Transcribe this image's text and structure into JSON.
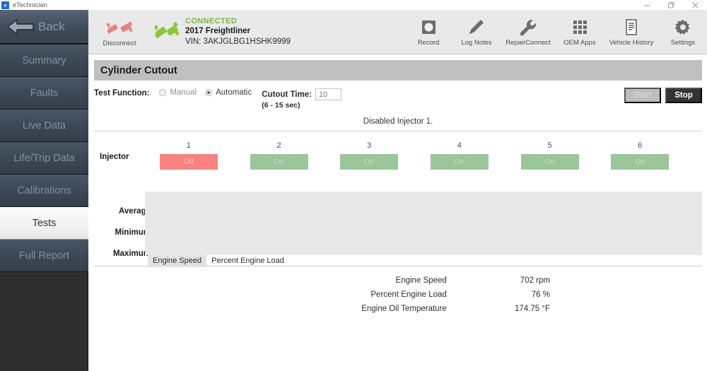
{
  "window": {
    "app_name": "eTechnician",
    "icon": "e-logo-icon",
    "minimize": "minimize-icon",
    "maximize": "restore-icon",
    "close": "close-icon"
  },
  "sidebar": {
    "back": {
      "label": "Back",
      "icon": "back-arrow-icon"
    },
    "items": [
      {
        "label": "Summary",
        "active": false
      },
      {
        "label": "Faults",
        "active": false
      },
      {
        "label": "Live Data",
        "active": false
      },
      {
        "label": "Life/Trip Data",
        "active": false
      },
      {
        "label": "Calibrations",
        "active": false
      },
      {
        "label": "Tests",
        "active": true
      },
      {
        "label": "Full Report",
        "active": false
      }
    ]
  },
  "toolbar": {
    "disconnect": {
      "label": "Disconnect",
      "icon": "disconnected-plug-icon"
    },
    "connection": {
      "status": "CONNECTED",
      "status_color": "#7ab648",
      "vehicle": "2017 Freightliner",
      "vin": "VIN: 3AKJGLBG1HSHK9999",
      "icon": "connected-plug-icon"
    },
    "actions": [
      {
        "label": "Record",
        "icon": "record-icon"
      },
      {
        "label": "Log Notes",
        "icon": "pencil-icon"
      },
      {
        "label": "RepairConnect",
        "icon": "wrench-icon"
      },
      {
        "label": "OEM Apps",
        "icon": "grid-apps-icon"
      },
      {
        "label": "Vehicle History",
        "icon": "document-icon"
      },
      {
        "label": "Settings",
        "icon": "gear-icon"
      }
    ]
  },
  "page": {
    "title": "Cylinder Cutout",
    "test_function_label": "Test Function:",
    "radio_options": [
      {
        "label": "Manual",
        "selected": false
      },
      {
        "label": "Automatic",
        "selected": true
      }
    ],
    "cutout_time_label": "Cutout Time:",
    "cutout_time_value": "10",
    "cutout_time_range": "(6 - 15 sec)",
    "start_button": "Start",
    "stop_button": "Stop",
    "status_message": "Disabled Injector 1."
  },
  "injectors": {
    "row_label": "Injector",
    "on_color": "#9bc59b",
    "off_color": "#f88280",
    "cells": [
      {
        "number": "1",
        "state": "Off"
      },
      {
        "number": "2",
        "state": "On"
      },
      {
        "number": "3",
        "state": "On"
      },
      {
        "number": "4",
        "state": "On"
      },
      {
        "number": "5",
        "state": "On"
      },
      {
        "number": "6",
        "state": "On"
      }
    ]
  },
  "stats": {
    "labels": [
      "Average",
      "Minimum",
      "Maximum"
    ]
  },
  "chart_data": {
    "type": "line",
    "title": "",
    "xlabel": "",
    "ylabel": "",
    "series": [],
    "tabs": [
      {
        "label": "Engine Speed",
        "active": true
      },
      {
        "label": "Percent Engine Load",
        "active": false
      }
    ],
    "note": "Plot area is empty (no data plotted yet)"
  },
  "readout": {
    "rows": [
      {
        "name": "Engine Speed",
        "value": "702 rpm"
      },
      {
        "name": "Percent Engine Load",
        "value": "76 %"
      },
      {
        "name": "Engine Oil Temperature",
        "value": "174.75 °F"
      }
    ]
  }
}
